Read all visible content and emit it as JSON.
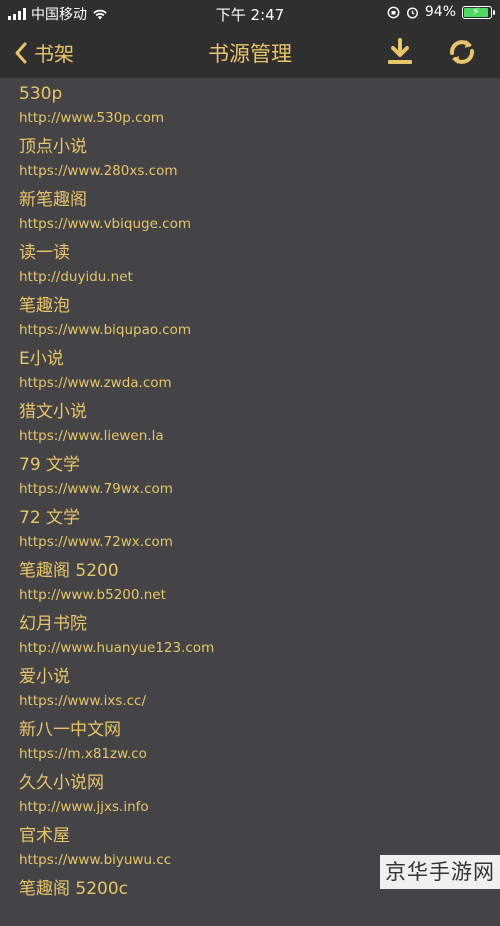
{
  "status_bar": {
    "carrier": "中国移动",
    "time": "下午 2:47",
    "battery_pct": "94%"
  },
  "nav": {
    "back_label": "书架",
    "title": "书源管理",
    "download_icon": "download-icon",
    "sync_icon": "sync-icon"
  },
  "sources": [
    {
      "name": "530p",
      "url": "http://www.530p.com"
    },
    {
      "name": "顶点小说",
      "url": "https://www.280xs.com"
    },
    {
      "name": "新笔趣阁",
      "url": "https://www.vbiquge.com"
    },
    {
      "name": "读一读",
      "url": "http://duyidu.net"
    },
    {
      "name": "笔趣泡",
      "url": "https://www.biqupao.com"
    },
    {
      "name": "E小说",
      "url": "https://www.zwda.com"
    },
    {
      "name": "猎文小说",
      "url": "https://www.liewen.la"
    },
    {
      "name": "79 文学",
      "url": "https://www.79wx.com"
    },
    {
      "name": "72 文学",
      "url": "https://www.72wx.com"
    },
    {
      "name": "笔趣阁 5200",
      "url": "http://www.b5200.net"
    },
    {
      "name": "幻月书院",
      "url": "http://www.huanyue123.com"
    },
    {
      "name": "爱小说",
      "url": "https://www.ixs.cc/"
    },
    {
      "name": "新八一中文网",
      "url": "https://m.x81zw.co"
    },
    {
      "name": "久久小说网",
      "url": "http://www.jjxs.info"
    },
    {
      "name": "官术屋",
      "url": "https://www.biyuwu.cc"
    },
    {
      "name": "笔趣阁 5200c",
      "url": ""
    }
  ],
  "watermark": "京华手游网",
  "colors": {
    "accent": "#e8c56a",
    "background": "#444446",
    "bar": "#2f2f30"
  }
}
